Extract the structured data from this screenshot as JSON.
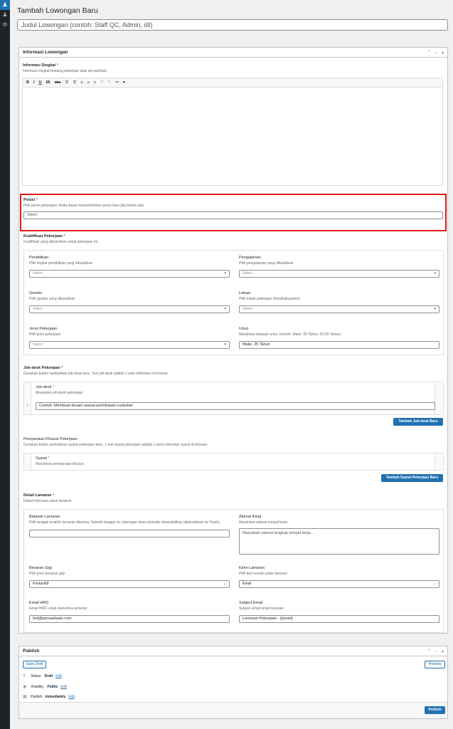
{
  "title": "Tambah Lowongan Baru",
  "title_placeholder": "Judul Lowongan (contoh: Staff QC, Admin, dll)",
  "box_info": {
    "title": "Informasi Lowongan",
    "info_label": "Informasi Singkat",
    "info_desc": "Informasi singkat tentang pekerjaan atau perusahaan",
    "toolbar": [
      "B",
      "I",
      "U",
      "66",
      "abc",
      "☰",
      "☰",
      "≡",
      "≡",
      "≡",
      "↶",
      "↷",
      "⚯",
      "⌖"
    ],
    "posisi_label": "Posisi",
    "posisi_desc": "Pilih posisi pekerjaan. Anda dapat menambahkan posisi baru jika belum ada.",
    "posisi_value": "Select",
    "kualifikasi_label": "Kualifikasi Pekerjaan",
    "kualifikasi_desc": "Kualifikasi yang dibutuhkan untuk pekerjaan ini",
    "pendidikan_label": "Pendidikan",
    "pendidikan_desc": "Pilih tingkat pendidikan yang dibutuhkan",
    "pendidikan_value": "Select",
    "pengalaman_label": "Pengalaman",
    "pengalaman_desc": "Pilih pengalaman yang dibutuhkan",
    "pengalaman_value": "Select",
    "gender_label": "Gender",
    "gender_desc": "Pilih gender yang dibutuhkan",
    "gender_value": "Select",
    "lokasi_label": "Lokasi",
    "lokasi_desc": "Pilih lokasi pekerjaan (kota/kabupaten)",
    "lokasi_value": "Select",
    "jenis_label": "Jenis Pekerjaan",
    "jenis_desc": "Pilih jenis pekerjaan",
    "jenis_value": "Select",
    "umur_label": "Umur",
    "umur_desc": "Masukkan batasan umur (contoh: Maks. 25 Tahun, 20-30 Tahun)",
    "umur_value": "Maks. 25 Tahun",
    "jobdesk_label": "Job-desk Pekerjaan",
    "jobdesk_desc": "Gunakan button tambahkan job-desk baru. Text job-desk adalah 1 poin informasi di browser",
    "jobdesk_sub_label": "Job-desk",
    "jobdesk_sub_desc": "Masukkan job-desk pekerjaan",
    "jobdesk_row_num": "1",
    "jobdesk_placeholder": "Contoh: Membuat desain sesuai permintaan customer",
    "jobdesk_button": "Tambah Job-desk Baru",
    "syarat_label": "Persyaratan Khusus Pekerjaan",
    "syarat_desc": "Gunakan button tambahkan syarat pekerjaan baru. 1 text syarat pekerjaan adalah 1 point informasi syarat di browser",
    "syarat_sub_label": "Syarat",
    "syarat_sub_desc": "Masukkan persyaratan khusus",
    "syarat_button": "Tambah Syarat Pekerjaan Baru",
    "detail_label": "Detail Lamaran",
    "detail_desc": "Detail informasi untuk lamaran",
    "batasan_label": "Batasan Lamaran",
    "batasan_desc": "Pilih tanggal terakhir lamaran diterima. Setelah tanggal ini, lowongan akan otomatis dinonaktifkan (dipindahkan ke Trash).",
    "alamat_label": "Alamat Kerja",
    "alamat_desc": "Masukkan alamat tempat kerja",
    "alamat_placeholder": "Masukkan alamat lengkap tempat kerja...",
    "gaji_label": "Besaran Gaji",
    "gaji_desc": "Pilih jenis besaran gaji",
    "gaji_value": "Kompetitif",
    "kirim_label": "Kirim Lamaran",
    "kirim_desc": "Pilih tipe kontak untuk lamaran",
    "kirim_value": "Email",
    "email_label": "Email HRD",
    "email_desc": "Email HRD untuk menerima lamaran",
    "email_value": "hrd@perusahaan.com",
    "subject_label": "Subject Email",
    "subject_desc": "Subject email untuk lamaran",
    "subject_value": "Lamaran Pekerjaan - {posisi}"
  },
  "publish": {
    "title": "Publish",
    "save_draft": "Save Draft",
    "preview": "Preview",
    "status_label": "Status:",
    "status_value": "Draft",
    "visibility_label": "Visibility:",
    "visibility_value": "Public",
    "publish_label": "Publish",
    "publish_value": "immediately",
    "edit": "Edit",
    "publish_button": "Publish"
  },
  "required_mark": "*",
  "colors": {
    "accent": "#2271b1",
    "highlight": "#e01b1b",
    "sidebar": "#1d2327"
  }
}
